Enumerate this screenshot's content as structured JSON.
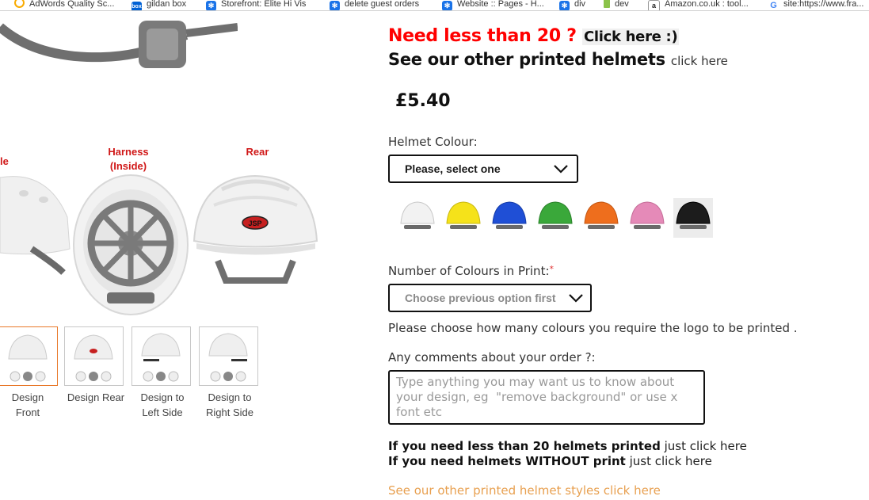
{
  "bookmarks": [
    {
      "label": "AdWords Quality Sc...",
      "icon": "adwords-icon",
      "color": "#f9ab00"
    },
    {
      "label": "gildan box",
      "icon": "box-icon",
      "color": "#0061d5"
    },
    {
      "label": "Storefront: Elite Hi Vis",
      "icon": "gear-icon",
      "color": "#1a73e8"
    },
    {
      "label": "delete guest orders",
      "icon": "gear-icon",
      "color": "#1a73e8"
    },
    {
      "label": "Website :: Pages - H...",
      "icon": "gear-icon",
      "color": "#1a73e8"
    },
    {
      "label": "div",
      "icon": "gear-icon",
      "color": "#1a73e8"
    },
    {
      "label": "dev",
      "icon": "bookmark-icon",
      "color": "#8bc34a"
    },
    {
      "label": "Amazon.co.uk : tool...",
      "icon": "amazon-icon",
      "color": "#222222"
    },
    {
      "label": "site:https://www.fra...",
      "icon": "google-icon",
      "color": "#4285f4"
    }
  ],
  "product_views": {
    "left_partial": "le",
    "harness": "Harness\n(Inside)",
    "rear": "Rear",
    "logo_text": "JSP"
  },
  "thumbnails": [
    {
      "caption": "Design\nFront",
      "active": true
    },
    {
      "caption": "Design Rear",
      "active": false
    },
    {
      "caption": "Design to\nLeft Side",
      "active": false
    },
    {
      "caption": "Design to\nRight Side",
      "active": false
    }
  ],
  "promo": {
    "line1": "Need less than 20 ?",
    "line1_link": "Click here :)",
    "line2": "See our other printed helmets",
    "line2_link": "click here"
  },
  "price": "£5.40",
  "helmet_colour": {
    "label": "Helmet Colour:",
    "selected": "Please, select one",
    "swatches": [
      {
        "name": "white",
        "color": "#f2f2f2"
      },
      {
        "name": "yellow",
        "color": "#f5e21a"
      },
      {
        "name": "blue",
        "color": "#1f4fd6"
      },
      {
        "name": "green",
        "color": "#3aa83a"
      },
      {
        "name": "orange",
        "color": "#ee6e1d"
      },
      {
        "name": "pink",
        "color": "#e58ab8"
      },
      {
        "name": "black",
        "color": "#1c1c1c"
      }
    ]
  },
  "print_colours": {
    "label": "Number of Colours in Print:",
    "required_mark": "*",
    "selected": "Choose previous option first",
    "help": "Please choose how many colours you require the logo to be printed ."
  },
  "comments": {
    "label": "Any comments about your order ?:",
    "placeholder": "Type anything you may want us to know about your design, eg  \"remove background\" or use x font etc"
  },
  "notes": {
    "line1_bold": "If you need less than 20 helmets printed",
    "line1_rest": " just click here",
    "line2_bold": "If you need helmets WITHOUT print",
    "line2_rest": " just click here"
  },
  "footer_link": "See our other printed helmet styles click here"
}
